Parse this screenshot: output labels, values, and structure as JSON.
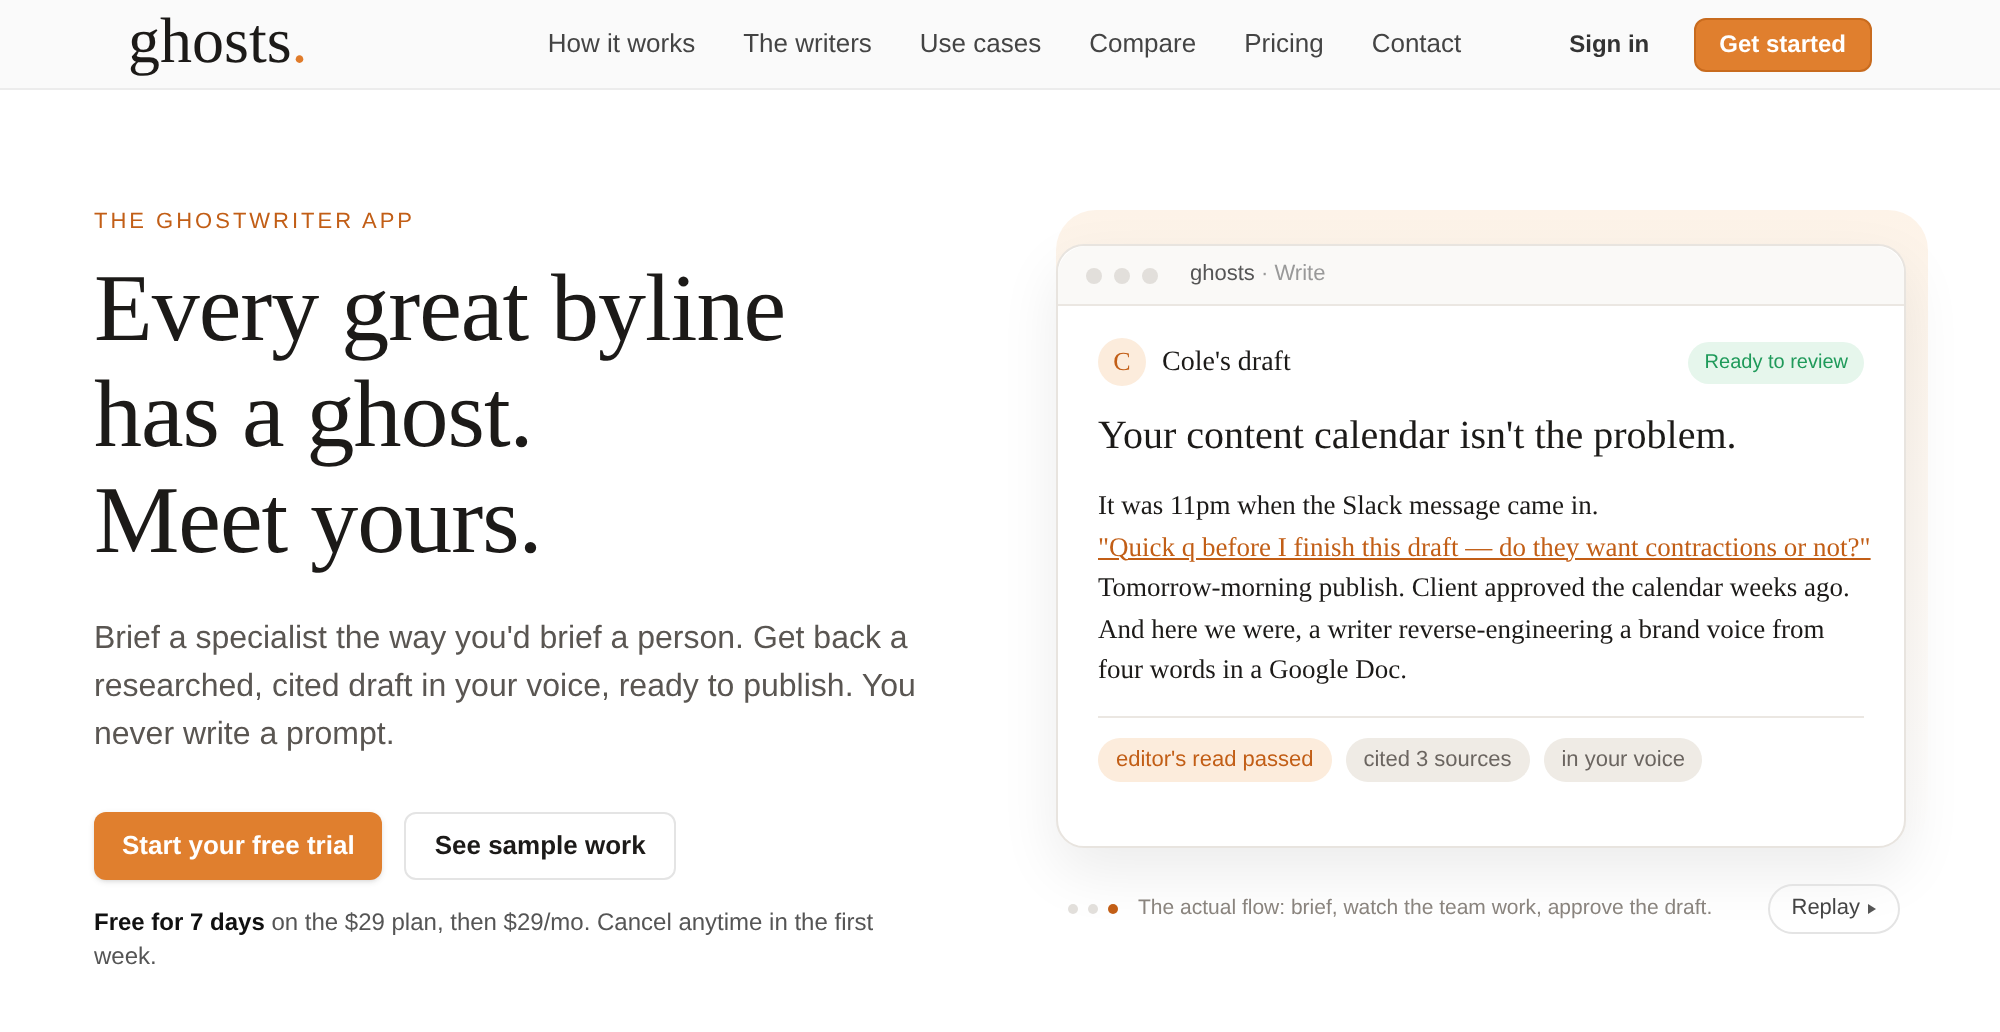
{
  "nav": {
    "logo": "ghosts",
    "logo_dot": ".",
    "links": [
      "How it works",
      "The writers",
      "Use cases",
      "Compare",
      "Pricing",
      "Contact"
    ],
    "sign_in": "Sign in",
    "cta": "Get started"
  },
  "hero": {
    "eyebrow": "THE GHOSTWRITER APP",
    "headline_lines": [
      "Every great byline",
      "has a ghost.",
      "Meet yours."
    ],
    "lead": "Brief a specialist the way you'd brief a person. Get back a researched, cited draft in your voice, ready to publish. You never write a prompt.",
    "primary_button": "Start your free trial",
    "secondary_button": "See sample work",
    "fine_print": "**Free for 7 days** on the $29 plan, then $29/mo. Cancel anytime in the first week."
  },
  "demo": {
    "window_title": "ghosts",
    "window_separator": "·",
    "window_subtitle": "Write",
    "avatar": "C",
    "draft_name": "Cole's draft",
    "status": "Ready to review",
    "title": "Your content calendar isn't the problem.",
    "body_before": "It was 11pm when the Slack message came in.",
    "body_link": "\"Quick q before I finish this draft — do they want contractions or not?\"",
    "body_after": "Tomorrow-morning publish. Client approved the calendar weeks ago. And here we were, a writer reverse-engineering a brand voice from four words in a Google Doc.",
    "tags": [
      {
        "label": "editor's read passed",
        "kind": "accent"
      },
      {
        "label": "cited 3 sources",
        "kind": "plain"
      },
      {
        "label": "in your voice",
        "kind": "plain"
      }
    ],
    "steps": [
      {
        "selected": false
      },
      {
        "selected": false
      },
      {
        "selected": true
      }
    ],
    "caption": "The actual flow: brief, watch the team work, approve the draft.",
    "replay": "Replay"
  }
}
